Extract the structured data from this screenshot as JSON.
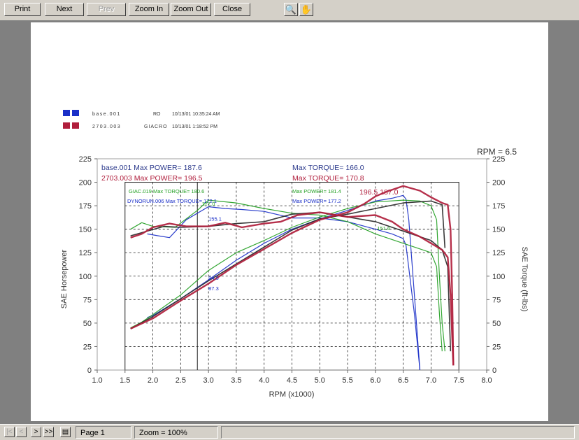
{
  "toolbar": {
    "print": "Print",
    "next": "Next",
    "prev": "Prev",
    "zoom_in": "Zoom In",
    "zoom_out": "Zoom Out",
    "close": "Close",
    "magnify_glyph": "🔍",
    "hand_glyph": "✋"
  },
  "status": {
    "first_glyph": "|<",
    "prev_glyph": "<",
    "next_glyph": ">",
    "last_glyph": ">>",
    "page": "Page 1",
    "zoom": "Zoom = 100%"
  },
  "legend": {
    "rows": [
      {
        "file": "base.001",
        "op": "RO",
        "date": "10/13/01 10:35:24 AM",
        "color": "#1a2fc8"
      },
      {
        "file": "2703.003",
        "op": "GIACRO",
        "date": "10/13/01 1:18:52 PM",
        "color": "#b01e3c"
      }
    ]
  },
  "chart_data": {
    "type": "line",
    "title": "",
    "xlabel": "RPM (x1000)",
    "ylabel": "SAE Horsepower",
    "y2label": "SAE Torque (ft-lbs)",
    "xlim": [
      1.0,
      8.0
    ],
    "ylim": [
      0,
      225
    ],
    "y2lim": [
      0,
      225
    ],
    "xticks": [
      "1.0",
      "1.5",
      "2.0",
      "2.5",
      "3.0",
      "3.5",
      "4.0",
      "4.5",
      "5.0",
      "5.5",
      "6.0",
      "6.5",
      "7.0",
      "7.5",
      "8.0"
    ],
    "yticks": [
      "0",
      "25",
      "50",
      "75",
      "100",
      "125",
      "150",
      "175",
      "200",
      "225"
    ],
    "grid": true,
    "rpm_readout": "RPM = 6.5",
    "cursor_x": 2.8,
    "inner_box": {
      "x": [
        1.5,
        7.5
      ],
      "y": [
        0,
        200
      ]
    },
    "annotations": {
      "base": "base.001  Max POWER= 187.6",
      "base_torque": "Max TORQUE= 166.0",
      "r2703": "2703.003  Max POWER= 196.5",
      "r2703_torque": "Max TORQUE= 170.8",
      "giac": "GIAC.019  Max TORQUE= 180.6",
      "giac_power": "Max POWER= 181.4",
      "dyno": "DYNORUN.006  Max TORQUE= 172.1",
      "dyno_power": "Max POWER= 177.2",
      "peak": "196.5  187.0",
      "cursor_values": [
        {
          "text": "177.0",
          "x": 2.88,
          "y": 175,
          "color": "#23a023"
        },
        {
          "text": "155.1",
          "x": 3.0,
          "y": 159,
          "color": "#1a2fc8"
        },
        {
          "text": "94.5",
          "x": 3.0,
          "y": 96,
          "color": "#1a2fc8"
        },
        {
          "text": "87.3",
          "x": 3.0,
          "y": 85,
          "color": "#1a2fc8"
        },
        {
          "text": "151.6",
          "x": 6.03,
          "y": 149,
          "color": "#23a023"
        }
      ]
    },
    "series": [
      {
        "kind": "hp",
        "color": "#1a2fc8",
        "width": 1.2,
        "x": [
          1.9,
          2.0,
          2.5,
          3.0,
          3.5,
          4.0,
          4.5,
          5.0,
          5.5,
          6.0,
          6.3,
          6.5,
          6.55,
          6.6,
          6.7,
          6.8
        ],
        "y": [
          56,
          58,
          76,
          96,
          117,
          135,
          150,
          161,
          170,
          180,
          183,
          186,
          182,
          160,
          80,
          0
        ]
      },
      {
        "kind": "tq",
        "color": "#1a2fc8",
        "width": 1.2,
        "x": [
          1.9,
          2.1,
          2.3,
          2.6,
          3.0,
          3.3,
          3.6,
          4.0,
          4.5,
          5.0,
          5.5,
          6.0,
          6.3,
          6.5,
          6.55,
          6.7,
          6.8
        ],
        "y": [
          145,
          143,
          141,
          160,
          174,
          172,
          171,
          169,
          162,
          162,
          158,
          150,
          145,
          140,
          133,
          60,
          0
        ]
      },
      {
        "kind": "hp",
        "color": "#23a023",
        "width": 1.2,
        "x": [
          1.6,
          1.8,
          2.0,
          2.5,
          3.0,
          3.5,
          4.0,
          4.5,
          5.0,
          5.5,
          6.0,
          6.5,
          6.8,
          7.0,
          7.1,
          7.15,
          7.2,
          7.25
        ],
        "y": [
          45,
          51,
          59,
          80,
          106,
          125,
          138,
          152,
          163,
          172,
          179,
          181,
          180,
          175,
          160,
          100,
          50,
          20
        ]
      },
      {
        "kind": "tq",
        "color": "#23a023",
        "width": 1.2,
        "x": [
          1.6,
          1.8,
          2.0,
          2.4,
          2.8,
          3.0,
          3.5,
          4.0,
          4.5,
          5.0,
          5.5,
          6.0,
          6.5,
          7.0,
          7.1,
          7.15,
          7.2
        ],
        "y": [
          150,
          157,
          153,
          152,
          170,
          181,
          178,
          172,
          167,
          165,
          158,
          145,
          135,
          125,
          110,
          60,
          20
        ]
      },
      {
        "kind": "hp",
        "color": "#2a2a2a",
        "width": 1.6,
        "x": [
          1.6,
          2.0,
          2.5,
          3.0,
          3.5,
          4.0,
          4.5,
          5.0,
          5.5,
          6.0,
          6.5,
          7.0,
          7.1,
          7.2,
          7.25
        ],
        "y": [
          44,
          57,
          76,
          95,
          113,
          131,
          149,
          161,
          166,
          172,
          178,
          180,
          178,
          176,
          130
        ]
      },
      {
        "kind": "tq",
        "color": "#2a2a2a",
        "width": 1.6,
        "x": [
          1.6,
          1.9,
          2.2,
          2.5,
          3.0,
          3.5,
          4.0,
          4.5,
          5.0,
          5.5,
          6.0,
          6.5,
          7.0,
          7.2,
          7.3,
          7.35
        ],
        "y": [
          143,
          148,
          153,
          152,
          153,
          156,
          158,
          166,
          168,
          163,
          158,
          148,
          138,
          128,
          110,
          20
        ]
      },
      {
        "kind": "hp",
        "color": "#b01e3c",
        "width": 2.4,
        "x": [
          1.6,
          2.0,
          2.5,
          3.0,
          3.5,
          4.0,
          4.5,
          5.0,
          5.5,
          5.8,
          6.0,
          6.2,
          6.5,
          6.8,
          7.0,
          7.2,
          7.3,
          7.35,
          7.38,
          7.4
        ],
        "y": [
          44,
          55,
          74,
          92,
          112,
          129,
          146,
          160,
          168,
          177,
          185,
          190,
          196,
          191,
          184,
          178,
          176,
          150,
          80,
          5
        ]
      },
      {
        "kind": "tq",
        "color": "#b01e3c",
        "width": 2.4,
        "x": [
          1.6,
          1.8,
          2.0,
          2.3,
          2.6,
          3.0,
          3.3,
          3.6,
          4.0,
          4.3,
          4.6,
          5.0,
          5.5,
          6.0,
          6.3,
          6.5,
          6.8,
          7.0,
          7.2,
          7.3,
          7.35,
          7.4
        ],
        "y": [
          141,
          145,
          152,
          156,
          153,
          153,
          157,
          152,
          156,
          158,
          165,
          168,
          163,
          165,
          158,
          150,
          142,
          135,
          128,
          120,
          80,
          5
        ]
      }
    ]
  }
}
